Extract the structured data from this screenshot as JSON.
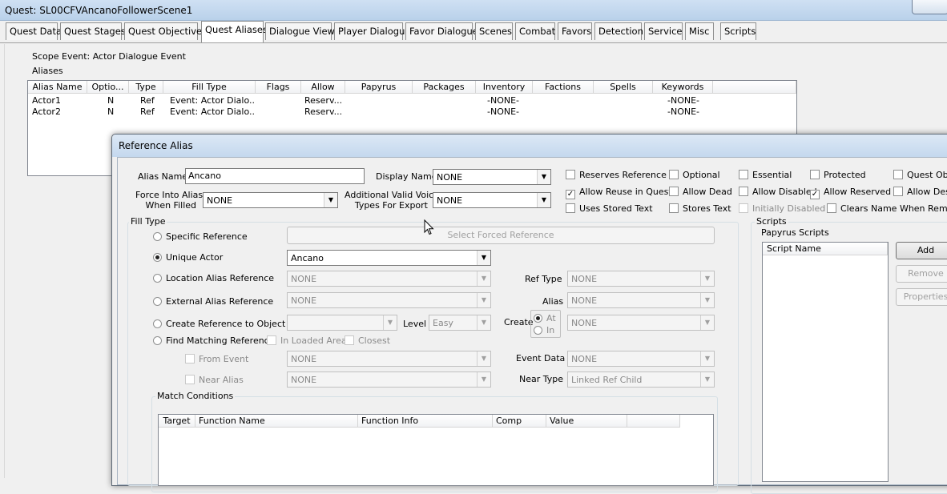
{
  "window": {
    "title": "Quest: SL00CFVAncanoFollowerScene1"
  },
  "tabs": [
    {
      "label": "Quest Data"
    },
    {
      "label": "Quest Stages"
    },
    {
      "label": "Quest Objectives"
    },
    {
      "label": "Quest Aliases"
    },
    {
      "label": "Dialogue Views"
    },
    {
      "label": "Player Dialogue"
    },
    {
      "label": "Favor Dialogue"
    },
    {
      "label": "Scenes"
    },
    {
      "label": "Combat"
    },
    {
      "label": "Favors"
    },
    {
      "label": "Detection"
    },
    {
      "label": "Service"
    },
    {
      "label": "Misc"
    },
    {
      "label": "Scripts"
    }
  ],
  "aliases": {
    "scope_event": "Scope Event: Actor Dialogue Event",
    "label": "Aliases",
    "columns": [
      "Alias Name",
      "Optio...",
      "Type",
      "Fill Type",
      "Flags",
      "Allow",
      "Papyrus",
      "Packages",
      "Inventory",
      "Factions",
      "Spells",
      "Keywords"
    ],
    "rows": [
      [
        "Actor1",
        "N",
        "Ref",
        "Event: Actor Dialo...",
        "",
        "Reserv...",
        "",
        "",
        "-NONE-",
        "",
        "",
        "-NONE-"
      ],
      [
        "Actor2",
        "N",
        "Ref",
        "Event: Actor Dialo...",
        "",
        "Reserv...",
        "",
        "",
        "-NONE-",
        "",
        "",
        "-NONE-"
      ]
    ]
  },
  "dialog": {
    "title": "Reference Alias",
    "alias_name_label": "Alias Name",
    "alias_name_value": "Ancano",
    "display_name_label": "Display Name",
    "display_name_value": "NONE",
    "force_into_label_1": "Force Into Alias",
    "force_into_label_2": "When Filled",
    "force_into_value": "NONE",
    "voice_types_label_1": "Additional Valid Voice",
    "voice_types_label_2": "Types For Export",
    "voice_types_value": "NONE",
    "flags": {
      "reserves_reference": "Reserves Reference",
      "optional": "Optional",
      "essential": "Essential",
      "protected": "Protected",
      "quest_object": "Quest Obj",
      "allow_reuse": "Allow Reuse in Quest",
      "allow_dead": "Allow Dead",
      "allow_disabled": "Allow Disabled",
      "allow_reserved": "Allow Reserved",
      "allow_destroyed": "Allow Dest",
      "uses_stored_text": "Uses Stored Text",
      "stores_text": "Stores Text",
      "initially_disabled": "Initially Disabled",
      "clears_name": "Clears Name When Remove"
    },
    "fill_type": {
      "label": "Fill Type",
      "specific_reference": "Specific Reference",
      "select_forced_reference": "Select Forced Reference",
      "unique_actor": "Unique Actor",
      "unique_actor_value": "Ancano",
      "location_alias_reference": "Location Alias Reference",
      "location_alias_value": "NONE",
      "ref_type_label": "Ref Type",
      "ref_type_value": "NONE",
      "external_alias_reference": "External Alias Reference",
      "external_alias_value": "NONE",
      "alias_label": "Alias",
      "alias_value": "NONE",
      "create_reference": "Create Reference to Object",
      "create_ref_value": "",
      "level_label": "Level",
      "level_value": "Easy",
      "create_label": "Create",
      "create_at": "At",
      "create_in": "In",
      "create_value": "NONE",
      "find_matching": "Find Matching Reference",
      "in_loaded_area": "In Loaded Area",
      "closest": "Closest",
      "from_event": "From Event",
      "from_event_value": "NONE",
      "event_data_label": "Event Data",
      "event_data_value": "NONE",
      "near_alias": "Near Alias",
      "near_alias_value": "NONE",
      "near_type_label": "Near Type",
      "near_type_value": "Linked Ref Child"
    },
    "match_conditions": {
      "label": "Match Conditions",
      "columns": [
        "Target",
        "Function Name",
        "Function Info",
        "Comp",
        "Value"
      ]
    },
    "scripts": {
      "label": "Scripts",
      "papyrus_label": "Papyrus Scripts",
      "column": "Script Name",
      "add": "Add",
      "remove": "Remove",
      "properties": "Properties"
    }
  }
}
